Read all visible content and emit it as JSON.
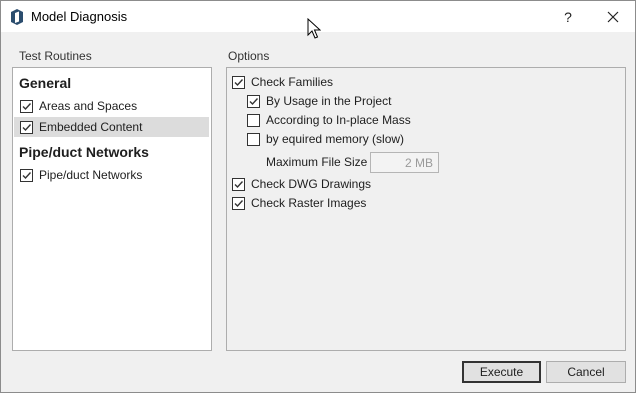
{
  "window": {
    "title": "Model Diagnosis",
    "help_label": "?",
    "icons": {
      "app": "app-logo-icon",
      "close": "close-icon",
      "cursor": "mouse-pointer-icon"
    }
  },
  "test_routines": {
    "title": "Test Routines",
    "groups": [
      {
        "header": "General",
        "items": [
          {
            "label": "Areas and Spaces",
            "checked": true,
            "selected": false
          },
          {
            "label": "Embedded Content",
            "checked": true,
            "selected": true
          }
        ]
      },
      {
        "header": "Pipe/duct Networks",
        "items": [
          {
            "label": "Pipe/duct Networks",
            "checked": true,
            "selected": false
          }
        ]
      }
    ]
  },
  "options": {
    "title": "Options",
    "check_families": {
      "label": "Check Families",
      "checked": true
    },
    "by_usage": {
      "label": "By Usage in the Project",
      "checked": true
    },
    "according_inplace": {
      "label": "According to In-place Mass",
      "checked": false
    },
    "by_memory": {
      "label": "by equired memory (slow)",
      "checked": false
    },
    "max_file_size": {
      "label": "Maximum File Size",
      "value": "2 MB"
    },
    "check_dwg": {
      "label": "Check DWG Drawings",
      "checked": true
    },
    "check_raster": {
      "label": "Check Raster Images",
      "checked": true
    }
  },
  "buttons": {
    "execute": "Execute",
    "cancel": "Cancel"
  }
}
